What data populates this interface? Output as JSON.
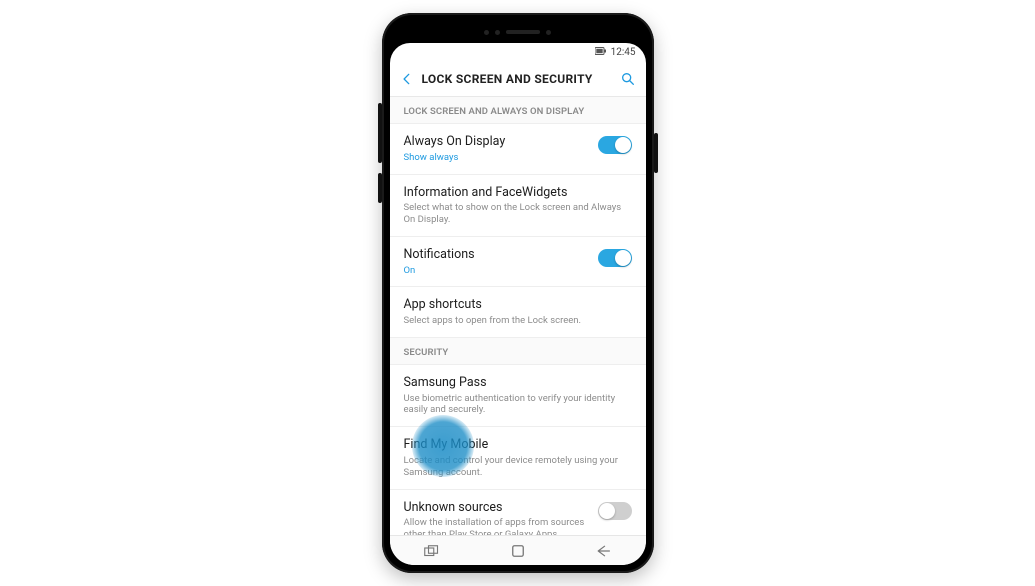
{
  "status": {
    "time": "12:45"
  },
  "topbar": {
    "title": "LOCK SCREEN AND SECURITY"
  },
  "section1_header": "LOCK SCREEN AND ALWAYS ON DISPLAY",
  "section2_header": "SECURITY",
  "rows": {
    "aod": {
      "title": "Always On Display",
      "sub": "Show always",
      "on": true
    },
    "widgets": {
      "title": "Information and FaceWidgets",
      "sub": "Select what to show on the Lock screen and Always On Display."
    },
    "notif": {
      "title": "Notifications",
      "sub": "On",
      "on": true
    },
    "shortcuts": {
      "title": "App shortcuts",
      "sub": "Select apps to open from the Lock screen."
    },
    "pass": {
      "title": "Samsung Pass",
      "sub": "Use biometric authentication to verify your identity easily and securely."
    },
    "findmy": {
      "title": "Find My Mobile",
      "sub": "Locate and control your device remotely using your Samsung account."
    },
    "unknown": {
      "title": "Unknown sources",
      "sub": "Allow the installation of apps from sources other than Play Store or Galaxy Apps.",
      "on": false
    }
  }
}
